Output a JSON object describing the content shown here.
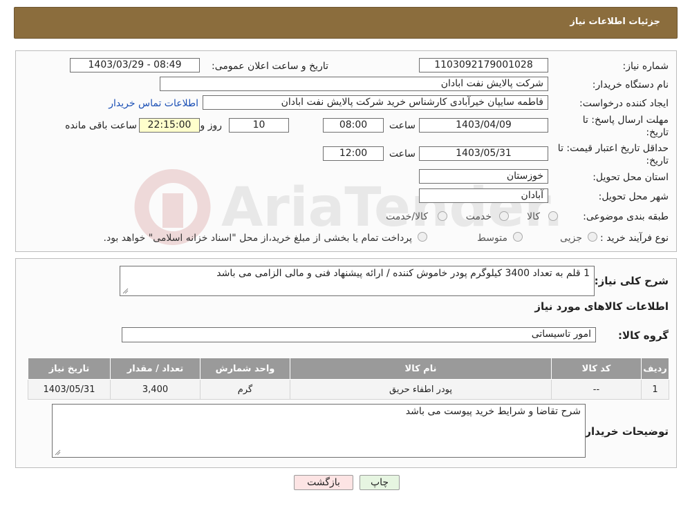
{
  "header": {
    "title": "جزئیات اطلاعات نیاز"
  },
  "form": {
    "need_number_label": "شماره نیاز:",
    "need_number": "1103092179001028",
    "announce_label": "تاریخ و ساعت اعلان عمومی:",
    "announce_value": "1403/03/29 - 08:49",
    "buyer_org_label": "نام دستگاه خریدار:",
    "buyer_org": "شرکت پالایش نفت ابادان",
    "creator_label": "ایجاد کننده درخواست:",
    "creator": "فاطمه سایپان خیرآبادی کارشناس خرید شرکت پالایش نفت ابادان",
    "contact_link": "اطلاعات تماس خریدار",
    "deadline_label_1": "مهلت ارسال پاسخ: تا",
    "deadline_label_2": "تاریخ:",
    "deadline_date": "1403/04/09",
    "time_label": "ساعت",
    "deadline_time": "08:00",
    "days_value": "10",
    "days_label": "روز و",
    "remaining_time": "22:15:00",
    "remaining_label": "ساعت باقی مانده",
    "validity_label_1": "حداقل تاریخ اعتبار قیمت: تا",
    "validity_label_2": "تاریخ:",
    "validity_date": "1403/05/31",
    "validity_time_label": "ساعت",
    "validity_time": "12:00",
    "province_label": "استان محل تحویل:",
    "province": "خوزستان",
    "city_label": "شهر محل تحویل:",
    "city": "آبادان",
    "category_label": "طبقه بندی موضوعی:",
    "category_options": [
      "کالا",
      "خدمت",
      "کالا/خدمت"
    ],
    "process_label": "نوع فرآیند خرید :",
    "process_options": [
      "جزیی",
      "متوسط"
    ],
    "process_note": "پرداخت تمام یا بخشی از مبلغ خرید،از محل \"اسناد خزانه اسلامی\" خواهد بود."
  },
  "details": {
    "desc_label": "شرح کلی نیاز:",
    "desc_value": "1 قلم به تعداد 3400 کیلوگرم پودر خاموش کننده / ارائه پیشنهاد فنی و  مالی الزامی می باشد",
    "goods_info_title": "اطلاعات کالاهای مورد نیاز",
    "goods_group_label": "گروه کالا:",
    "goods_group": "امور تاسیساتی",
    "table": {
      "headers": [
        "ردیف",
        "کد کالا",
        "نام کالا",
        "واحد شمارش",
        "تعداد / مقدار",
        "تاریخ نیاز"
      ],
      "rows": [
        [
          "1",
          "--",
          "پودر اطفاء حریق",
          "گرم",
          "3,400",
          "1403/05/31"
        ]
      ]
    },
    "buyer_notes_label": "توضیحات خریدار:",
    "buyer_notes": "شرح تقاضا و شرایط خرید پیوست می باشد"
  },
  "buttons": {
    "print": "چاپ",
    "back": "بازگشت"
  },
  "watermark_text": "AriaTender.neT",
  "colors": {
    "title_bar": "#8b6d3d",
    "remaining_bg": "#ffffcc",
    "link": "#1a4fb5",
    "back_btn_bg": "#fde4e4",
    "print_btn_bg": "#e6f5e1"
  }
}
